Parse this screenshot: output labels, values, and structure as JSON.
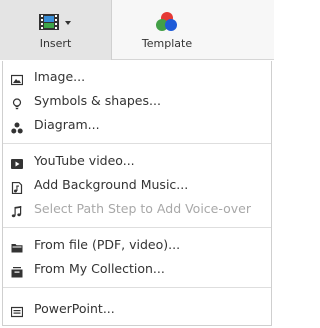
{
  "toolbar": {
    "insert_label": "Insert",
    "template_label": "Template",
    "colors": {
      "red": "#e53935",
      "green": "#43a047",
      "blue": "#1e5bd8",
      "active_bg": "#e4e4e4"
    }
  },
  "menu": {
    "items": [
      {
        "label": "Image...",
        "icon": "image-icon",
        "disabled": false
      },
      {
        "label": "Symbols & shapes...",
        "icon": "lightbulb-icon",
        "disabled": false
      },
      {
        "label": "Diagram...",
        "icon": "diagram-icon",
        "disabled": false
      },
      {
        "label": "YouTube video...",
        "icon": "play-icon",
        "disabled": false
      },
      {
        "label": "Add Background Music...",
        "icon": "music-file-icon",
        "disabled": false
      },
      {
        "label": "Select Path Step to Add Voice-over",
        "icon": "music-note-icon",
        "disabled": true
      },
      {
        "label": "From file (PDF, video)...",
        "icon": "folder-icon",
        "disabled": false
      },
      {
        "label": "From My Collection...",
        "icon": "collection-icon",
        "disabled": false
      },
      {
        "label": "PowerPoint...",
        "icon": "powerpoint-icon",
        "disabled": false
      }
    ]
  }
}
